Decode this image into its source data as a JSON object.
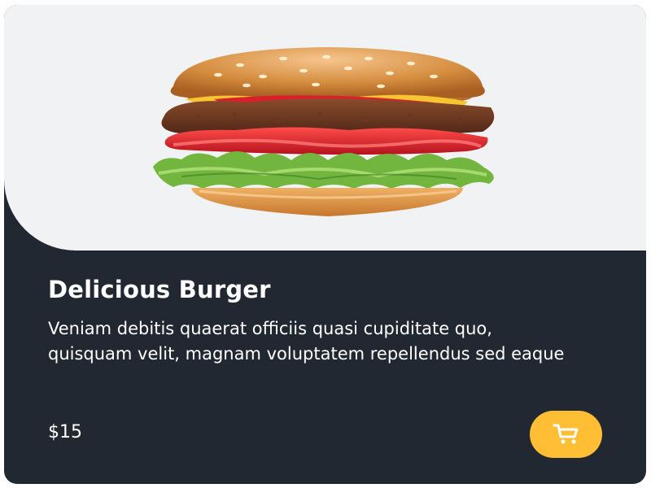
{
  "card": {
    "title": "Delicious Burger",
    "description": "Veniam debitis quaerat officiis quasi cupiditate quo, quisquam velit, magnam voluptatem repellendus sed eaque",
    "price": "$15",
    "image_icon": "burger-image",
    "cart_icon": "cart-icon"
  },
  "colors": {
    "card_background": "#222831",
    "image_background": "#f1f2f3",
    "accent": "#ffbe33",
    "text": "#ffffff"
  }
}
